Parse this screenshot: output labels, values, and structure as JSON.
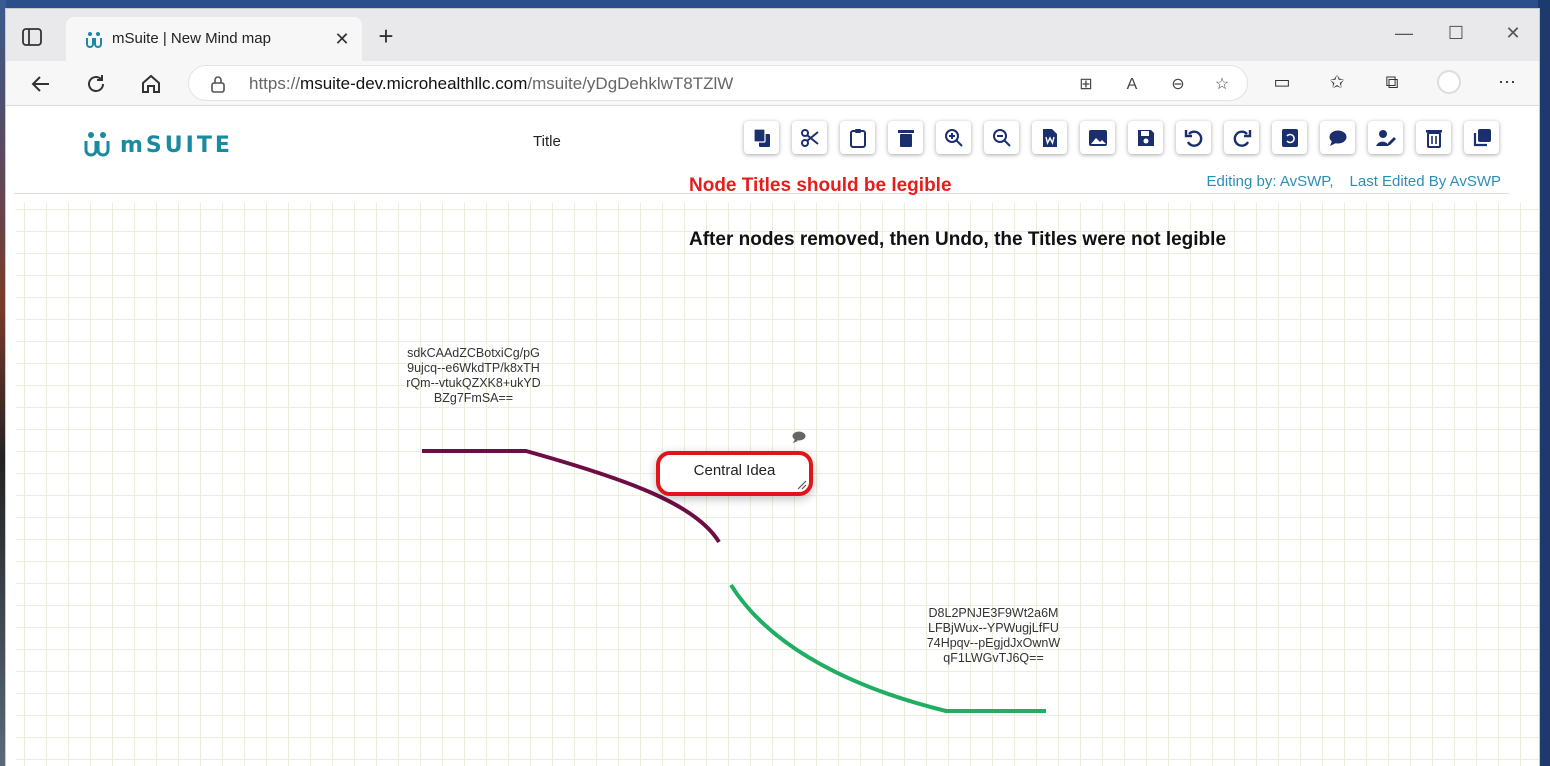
{
  "browser": {
    "tab_title": "mSuite | New Mind map",
    "url_prefix": "https://",
    "url_host": "msuite-dev.microhealthllc.com",
    "url_path": "/msuite/yDgDehklwT8TZlW",
    "colors": {
      "accent": "#1a8aa0"
    }
  },
  "app": {
    "logo_text": "mSUITE",
    "title": "Title",
    "toolbar": [
      "copy-icon",
      "cut-icon",
      "paste-icon",
      "delete-icon",
      "zoom-in-icon",
      "zoom-out-icon",
      "word-export-icon",
      "image-export-icon",
      "save-icon",
      "undo-icon",
      "redo-icon",
      "reset-icon",
      "comment-icon",
      "edit-user-icon",
      "trash-icon",
      "duplicate-icon"
    ],
    "editing_by": "Editing by: AvSWP,",
    "last_edited": "Last Edited By AvSWP"
  },
  "canvas": {
    "note_red": "Node Titles should be legible",
    "note_black": "After nodes removed, then Undo, the Titles were not legible",
    "central_node": "Central Idea",
    "node_top_left": "sdkCAAdZCBotxiCg/pG9ujcq--e6WkdTP/k8xTHrQm--vtukQZXK8+ukYDBZg7FmSA==",
    "node_bottom_right": "D8L2PNJE3F9Wt2a6MLFBjWux--YPWugjLfFU74Hpqv--pEgjdJxOwnWqF1LWGvTJ6Q==",
    "colors": {
      "top_link": "#6e0d45",
      "bottom_link": "#1fae62",
      "central_border": "#e1141c"
    }
  }
}
